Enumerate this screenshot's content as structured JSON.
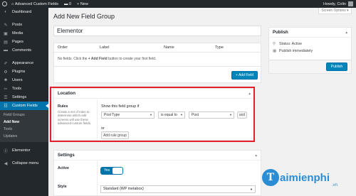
{
  "adminbar": {
    "site_name": "Advanced Custom Fields",
    "comments_count": "0",
    "new_label": "+ New",
    "greeting": "Howdy, Colin"
  },
  "sidebar": {
    "items": [
      {
        "label": "Dashboard",
        "icon": "dashboard-icon",
        "glyph": "◐"
      },
      {
        "label": "Posts",
        "icon": "pin-icon",
        "glyph": "✎"
      },
      {
        "label": "Media",
        "icon": "media-icon",
        "glyph": "▣"
      },
      {
        "label": "Pages",
        "icon": "page-icon",
        "glyph": "▤"
      },
      {
        "label": "Comments",
        "icon": "comment-icon",
        "glyph": "▬"
      }
    ],
    "items2": [
      {
        "label": "Appearance",
        "icon": "brush-icon",
        "glyph": "✐"
      },
      {
        "label": "Plugins",
        "icon": "plugin-icon",
        "glyph": "⚙"
      },
      {
        "label": "Users",
        "icon": "user-icon",
        "glyph": "☻"
      },
      {
        "label": "Tools",
        "icon": "wrench-icon",
        "glyph": "✂"
      },
      {
        "label": "Settings",
        "icon": "settings-icon",
        "glyph": "☰"
      }
    ],
    "active": {
      "label": "Custom Fields",
      "icon": "list-icon",
      "glyph": "☷"
    },
    "submenu": [
      "Field Groups",
      "Add New",
      "Tools",
      "Updates"
    ],
    "elementor": {
      "label": "Elementor",
      "icon": "elementor-icon",
      "glyph": "ⓔ"
    },
    "collapse": {
      "label": "Collapse menu",
      "icon": "collapse-icon",
      "glyph": "◀"
    }
  },
  "screen_options": "Screen Options ▾",
  "page_title": "Add New Field Group",
  "title_value": "Elementor",
  "fields": {
    "headers": [
      "Order",
      "Label",
      "Name",
      "Type"
    ],
    "empty_pre": "No fields. Click the ",
    "empty_btn": "+ Add Field",
    "empty_post": " button to create your first field.",
    "add_button": "+ Add Field"
  },
  "publish": {
    "title": "Publish",
    "status": "Status: Active",
    "schedule": "Publish immediately",
    "button": "Publish"
  },
  "location": {
    "title": "Location",
    "rules_label": "Rules",
    "rules_desc": "Create a set of rules to determine which edit screens will use these advanced custom fields",
    "show_if": "Show this field group if",
    "param": "Post Type",
    "operator": "is equal to",
    "value": "Post",
    "and_button": "and",
    "or_label": "or",
    "add_rule_group": "Add rule group"
  },
  "settings": {
    "title": "Settings",
    "active_label": "Active",
    "toggle_text": "Yes",
    "style_label": "Style",
    "style_value": "Standard (WP metabox)"
  },
  "watermark": {
    "letter": "T",
    "text": "aimienphi",
    "domain": ".vn"
  }
}
